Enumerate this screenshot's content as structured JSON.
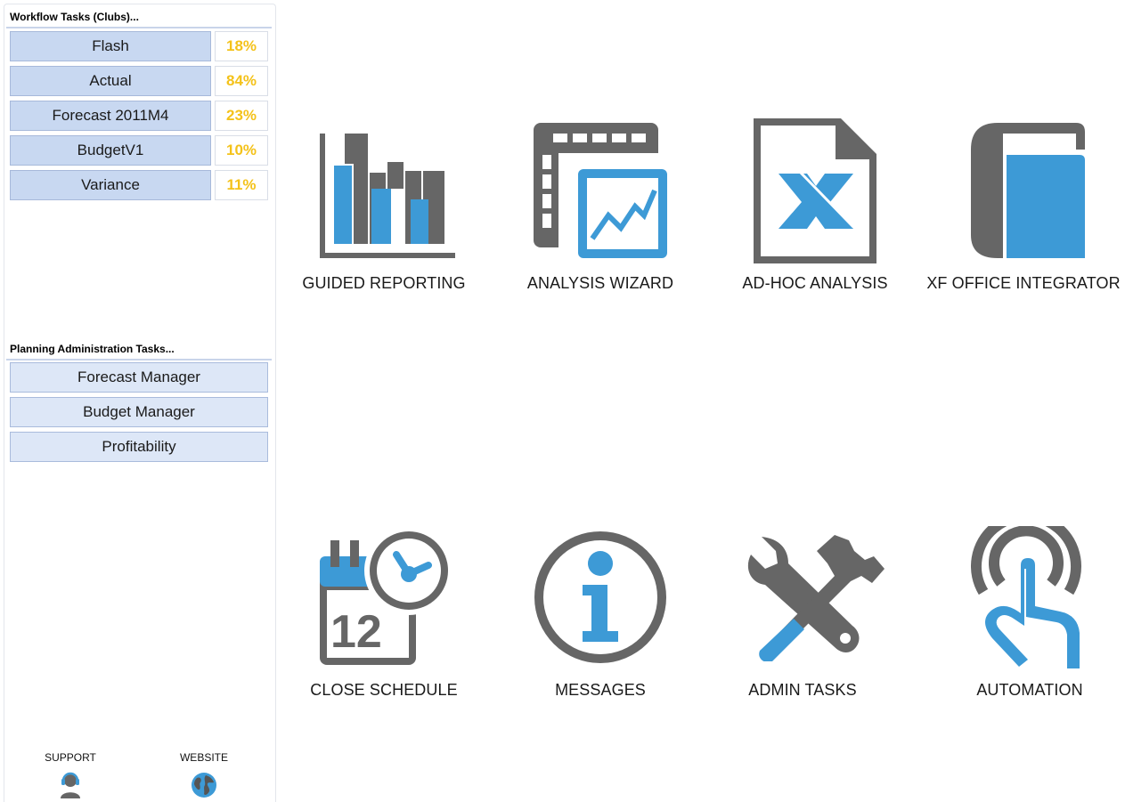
{
  "workflow": {
    "title": "Workflow Tasks (Clubs)...",
    "items": [
      {
        "label": "Flash",
        "pct": "18%"
      },
      {
        "label": "Actual",
        "pct": "84%"
      },
      {
        "label": "Forecast 2011M4",
        "pct": "23%"
      },
      {
        "label": "BudgetV1",
        "pct": "10%"
      },
      {
        "label": "Variance",
        "pct": "11%"
      }
    ]
  },
  "planning": {
    "title": "Planning Administration Tasks...",
    "items": [
      {
        "label": "Forecast Manager"
      },
      {
        "label": "Budget Manager"
      },
      {
        "label": "Profitability"
      }
    ]
  },
  "footer": {
    "support": {
      "label": "SUPPORT",
      "icon": "headset-user-icon"
    },
    "website": {
      "label": "WEBSITE",
      "icon": "globe-icon"
    }
  },
  "tiles": [
    {
      "label": "GUIDED REPORTING",
      "icon": "bar-chart-icon"
    },
    {
      "label": "ANALYSIS WIZARD",
      "icon": "spreadsheet-chart-icon"
    },
    {
      "label": "AD-HOC ANALYSIS",
      "icon": "excel-document-icon"
    },
    {
      "label": "XF OFFICE INTEGRATOR",
      "icon": "book-icon"
    },
    {
      "label": "CLOSE SCHEDULE",
      "icon": "calendar-clock-icon"
    },
    {
      "label": "MESSAGES",
      "icon": "info-icon"
    },
    {
      "label": "ADMIN TASKS",
      "icon": "wrench-hammer-icon"
    },
    {
      "label": "AUTOMATION",
      "icon": "touch-icon"
    }
  ],
  "colors": {
    "accent_blue": "#3d9ad6",
    "icon_gray": "#666666",
    "percent_yellow": "#f4c21a",
    "button_blue": "#c8d8f1",
    "button_light": "#dde7f7"
  }
}
